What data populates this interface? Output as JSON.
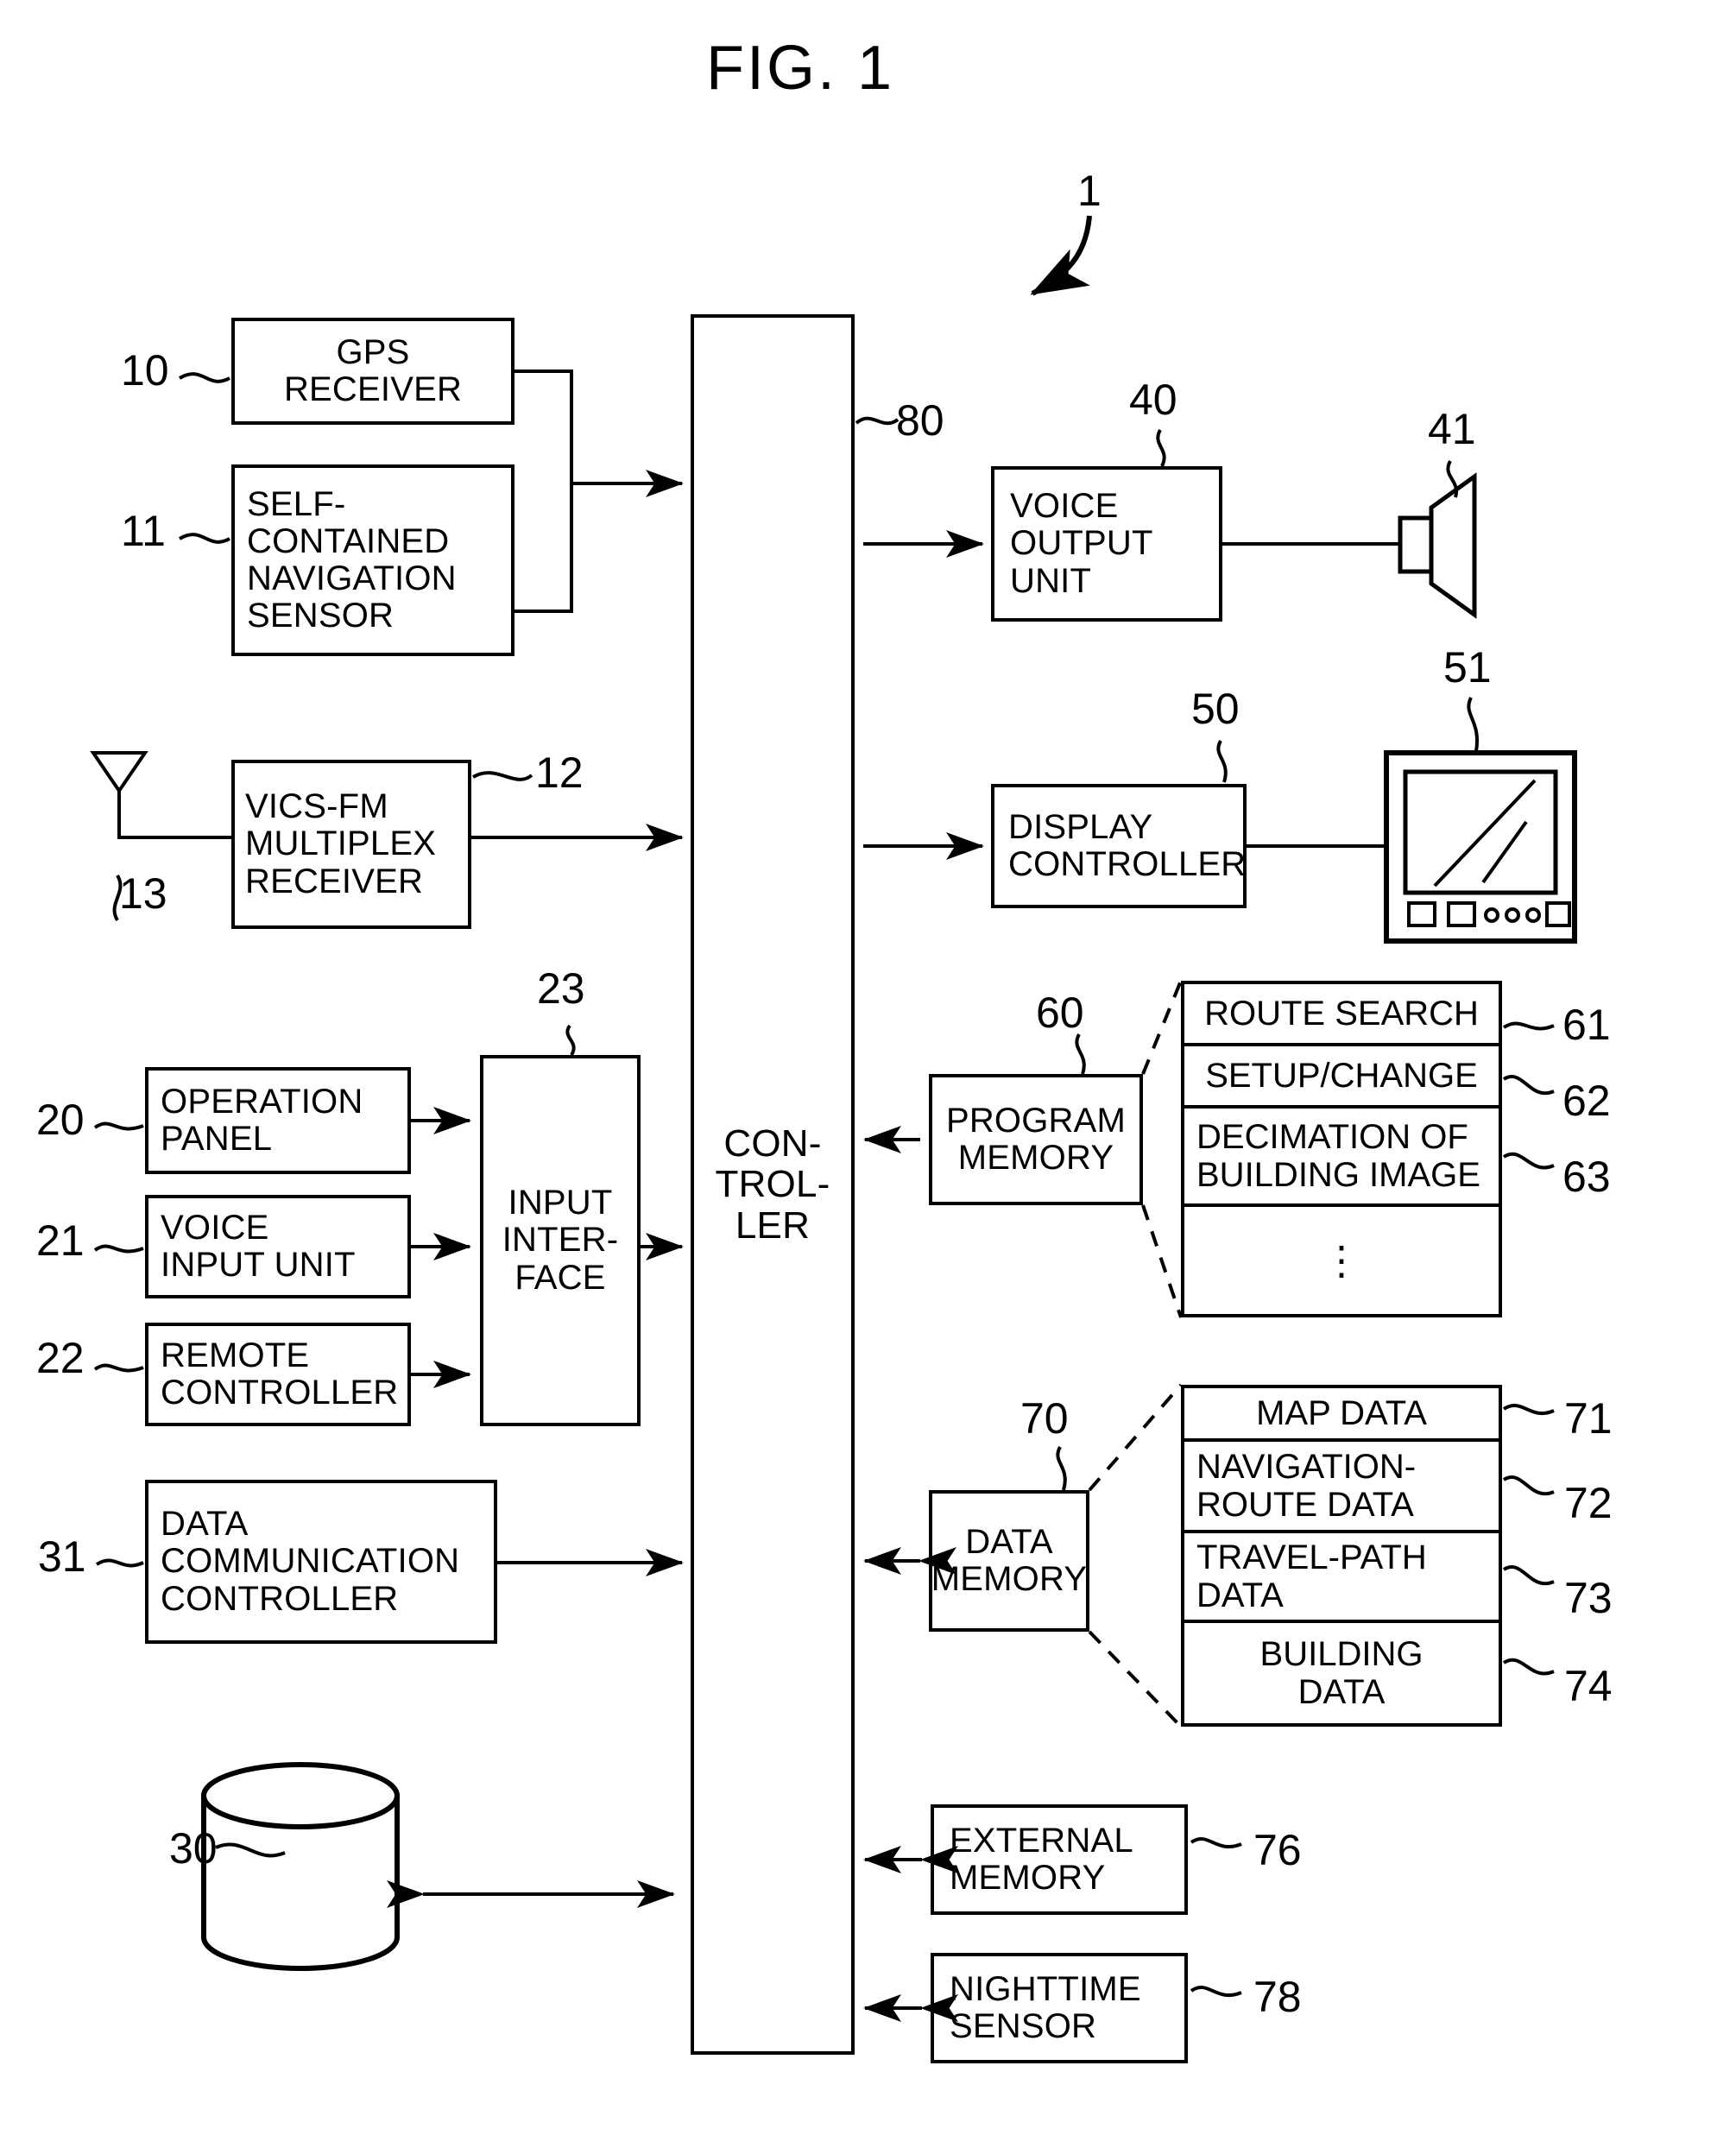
{
  "figure": {
    "title": "FIG. 1",
    "system_ref": "1"
  },
  "blocks": {
    "gps_receiver": {
      "label": "GPS\nRECEIVER",
      "ref": "10"
    },
    "self_contained": {
      "label": "SELF-\nCONTAINED\nNAVIGATION\nSENSOR",
      "ref": "11"
    },
    "vics_receiver": {
      "label": "VICS-FM\nMULTIPLEX\nRECEIVER",
      "ref": "12"
    },
    "antenna": {
      "ref": "13"
    },
    "operation_panel": {
      "label": "OPERATION\nPANEL",
      "ref": "20"
    },
    "voice_input_unit": {
      "label": "VOICE\nINPUT UNIT",
      "ref": "21"
    },
    "remote_controller": {
      "label": "REMOTE\nCONTROLLER",
      "ref": "22"
    },
    "input_interface": {
      "label": "INPUT\nINTER-\nFACE",
      "ref": "23"
    },
    "storage_disk": {
      "ref": "30"
    },
    "data_comm_ctrl": {
      "label": "DATA\nCOMMUNICATION\nCONTROLLER",
      "ref": "31"
    },
    "voice_output_unit": {
      "label": "VOICE\nOUTPUT\nUNIT",
      "ref": "40"
    },
    "speaker": {
      "ref": "41"
    },
    "display_controller": {
      "label": "DISPLAY\nCONTROLLER",
      "ref": "50"
    },
    "monitor": {
      "ref": "51"
    },
    "program_memory": {
      "label": "PROGRAM\nMEMORY",
      "ref": "60"
    },
    "data_memory": {
      "label": "DATA\nMEMORY",
      "ref": "70"
    },
    "external_memory": {
      "label": "EXTERNAL\nMEMORY",
      "ref": "76"
    },
    "nighttime_sensor": {
      "label": "NIGHTTIME\nSENSOR",
      "ref": "78"
    },
    "controller": {
      "label": "CON-\nTROL-\nLER",
      "ref": "80"
    }
  },
  "program_memory_contents": [
    {
      "label": "ROUTE SEARCH",
      "ref": "61"
    },
    {
      "label": "SETUP/CHANGE",
      "ref": "62"
    },
    {
      "label": "DECIMATION OF\nBUILDING IMAGE",
      "ref": "63"
    },
    {
      "label": "⋮",
      "ref": ""
    }
  ],
  "data_memory_contents": [
    {
      "label": "MAP DATA",
      "ref": "71"
    },
    {
      "label": "NAVIGATION-\nROUTE DATA",
      "ref": "72"
    },
    {
      "label": "TRAVEL-PATH\nDATA",
      "ref": "73"
    },
    {
      "label": "BUILDING\nDATA",
      "ref": "74"
    }
  ],
  "colors": {
    "ink": "#000000",
    "paper": "#ffffff"
  }
}
